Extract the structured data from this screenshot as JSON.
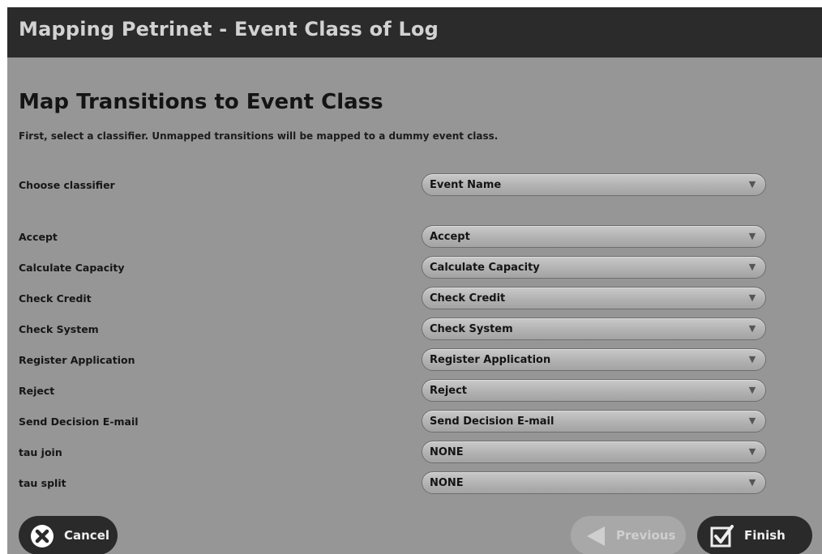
{
  "window": {
    "title": "Mapping Petrinet - Event Class of Log"
  },
  "main": {
    "heading": "Map Transitions to Event Class",
    "subtitle": "First, select a classifier. Unmapped transitions will be mapped to a dummy event class.",
    "classifier": {
      "label": "Choose classifier",
      "value": "Event Name"
    },
    "mappings": [
      {
        "label": "Accept",
        "value": "Accept"
      },
      {
        "label": "Calculate Capacity",
        "value": "Calculate Capacity"
      },
      {
        "label": "Check Credit",
        "value": "Check Credit"
      },
      {
        "label": "Check System",
        "value": "Check System"
      },
      {
        "label": "Register Application",
        "value": "Register Application"
      },
      {
        "label": "Reject",
        "value": "Reject"
      },
      {
        "label": "Send Decision E-mail",
        "value": "Send Decision E-mail"
      },
      {
        "label": "tau join",
        "value": "NONE"
      },
      {
        "label": "tau split",
        "value": "NONE"
      }
    ]
  },
  "footer": {
    "cancel_label": "Cancel",
    "previous_label": "Previous",
    "finish_label": "Finish"
  },
  "icons": {
    "cancel": "x-icon",
    "previous": "left-arrow-icon",
    "finish": "checkbox-icon",
    "dropdown": "dropdown-arrow-icon"
  },
  "colors": {
    "titlebar": "#2b2b2b",
    "background": "#969696",
    "button_dark": "#2a2a2a",
    "button_disabled": "#a8a8a8"
  }
}
